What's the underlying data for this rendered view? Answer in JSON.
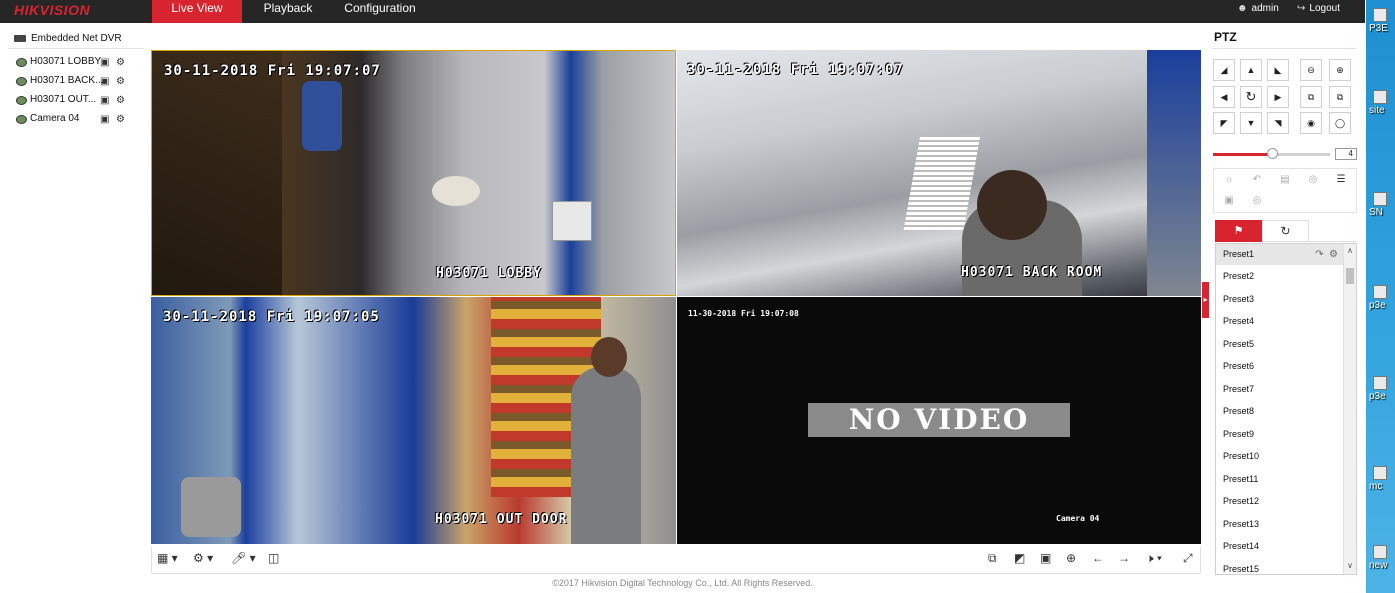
{
  "brand": "HIKVISION",
  "nav": {
    "tabs": [
      {
        "label": "Live View"
      },
      {
        "label": "Playback"
      },
      {
        "label": "Configuration"
      }
    ],
    "user": "admin",
    "logout": "Logout"
  },
  "tree": {
    "device": "Embedded Net DVR",
    "cameras": [
      {
        "label": "H03071 LOBBY"
      },
      {
        "label": "H03071 BACK..."
      },
      {
        "label": "H03071 OUT..."
      },
      {
        "label": "Camera 04"
      }
    ]
  },
  "video": {
    "panes": [
      {
        "time": "30-11-2018 Fri 19:07:07",
        "name": "H03071 LOBBY"
      },
      {
        "time": "30-11-2018 Fri 19:07:07",
        "name": "H03071 BACK ROOM"
      },
      {
        "time": "30-11-2018 Fri 19:07:05",
        "name": "H03071 OUT DOOR"
      },
      {
        "time": "11-30-2018 Fri 19:07:08",
        "name": "Camera 04",
        "message": "NO VIDEO"
      }
    ]
  },
  "footer": {
    "copyright": "©2017 Hikvision Digital Technology Co., Ltd. All Rights Reserved."
  },
  "ptz": {
    "title": "PTZ",
    "speed": 4,
    "speed_min": 1,
    "speed_max": 7,
    "presets": [
      "Preset1",
      "Preset2",
      "Preset3",
      "Preset4",
      "Preset5",
      "Preset6",
      "Preset7",
      "Preset8",
      "Preset9",
      "Preset10",
      "Preset11",
      "Preset12",
      "Preset13",
      "Preset14",
      "Preset15"
    ]
  },
  "desktop": {
    "items": [
      "P3E",
      "site",
      "SN",
      "p3e",
      "p3e",
      "mc",
      "new"
    ]
  },
  "colors": {
    "accent": "#d8242e",
    "topbar": "#262626",
    "active_pane_border": "#d9a400"
  }
}
